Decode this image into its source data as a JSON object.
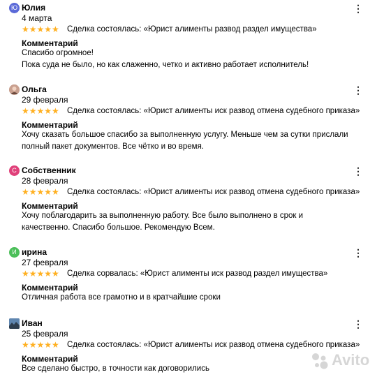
{
  "reviews": [
    {
      "name": "Юлия",
      "avatar_letter": "Ю",
      "avatar_color": "#5b6ad8",
      "date": "4 марта",
      "stars": "★★★★★",
      "deal": "Сделка состоялась: «Юрист алименты развод раздел имущества»",
      "comment_label": "Комментарий",
      "comment": "Спасибо огромное!\nПока суда не было, но как слаженно, четко и активно работает исполнитель!"
    },
    {
      "name": "Ольга",
      "avatar_letter": "",
      "avatar_color": "#b98a7a",
      "date": "29 февраля",
      "stars": "★★★★★",
      "deal": "Сделка состоялась: «Юрист алименты иск развод отмена судебного приказа»",
      "comment_label": "Комментарий",
      "comment": "Хочу сказать большое спасибо за выполненную услугу. Меньше чем за сутки прислали полный пакет документов. Все чётко и во время."
    },
    {
      "name": "Собственник",
      "avatar_letter": "С",
      "avatar_color": "#e0407a",
      "date": "28 февраля",
      "stars": "★★★★★",
      "deal": "Сделка состоялась: «Юрист алименты иск развод отмена судебного приказа»",
      "comment_label": "Комментарий",
      "comment": "Хочу поблагодарить за выполненную работу. Все было выполнено в срок и качественно. Спасибо большое. Рекомендую Всем."
    },
    {
      "name": "ирина",
      "avatar_letter": "И",
      "avatar_color": "#4cbf5a",
      "date": "27 февраля",
      "stars": "★★★★★",
      "deal": "Сделка сорвалась: «Юрист алименты иск развод раздел имущества»",
      "comment_label": "Комментарий",
      "comment": "Отличная работа все грамотно и в кратчайшие сроки"
    },
    {
      "name": "Иван",
      "avatar_letter": "",
      "avatar_color": "#4a6b8c",
      "date": "25 февраля",
      "stars": "★★★★★",
      "deal": "Сделка состоялась: «Юрист алименты иск развод отмена судебного приказа»",
      "comment_label": "Комментарий",
      "comment": "Все сделано быстро, в точности как договорились"
    }
  ],
  "watermark": "Avito",
  "star_color": "#ffb021"
}
